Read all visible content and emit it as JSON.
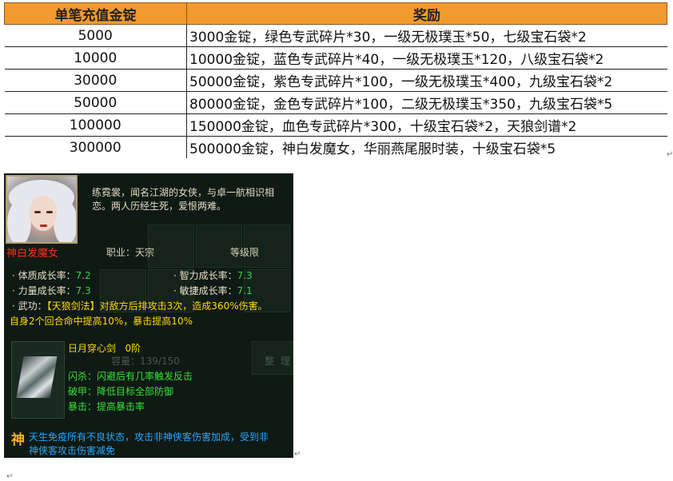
{
  "reward_table": {
    "headers": [
      "单笔充值金锭",
      "奖励"
    ],
    "rows": [
      {
        "amount": "5000",
        "reward": "3000金锭，绿色专武碎片*30，一级无极璞玉*50，七级宝石袋*2"
      },
      {
        "amount": "10000",
        "reward": "10000金锭，蓝色专武碎片*40，一级无极璞玉*120，八级宝石袋*2"
      },
      {
        "amount": "30000",
        "reward": "50000金锭，紫色专武碎片*100，一级无极璞玉*400，九级宝石袋*2"
      },
      {
        "amount": "50000",
        "reward": "80000金锭，金色专武碎片*100，二级无极璞玉*350，九级宝石袋*5"
      },
      {
        "amount": "100000",
        "reward": "150000金锭，血色专武碎片*300，十级宝石袋*2，天狼剑谱*2"
      },
      {
        "amount": "300000",
        "reward": "500000金锭，神白发魔女，华丽燕尾服时装，十级宝石袋*5"
      }
    ]
  },
  "hero": {
    "description": "练霓裳，闻名江湖的女侠，与卓一航相识相恋。两人历经生死，爱恨两难。",
    "name": "神白发魔女",
    "profession": "职业：天宗",
    "level_limit": "等级限",
    "stats": {
      "constitution_label": "体质成长率：",
      "constitution_value": "7.2",
      "intelligence_label": "智力成长率：",
      "intelligence_value": "7.3",
      "strength_label": "力量成长率：",
      "strength_value": "7.3",
      "agility_label": "敏捷成长率：",
      "agility_value": "7.1"
    },
    "martial_art": {
      "label": "武功：",
      "name": "【天狼剑法】",
      "effect_line1": "对敌方后排攻击3次，造成360%伤害。",
      "effect_line2": "自身2个回合命中提高10%，暴击提高10%"
    },
    "weapon": {
      "name": "日月穿心剑",
      "level": "0阶",
      "effects": [
        "闪杀：闪避后有几率触发反击",
        "破甲：降低目标全部防御",
        "暴击：提高暴击率"
      ]
    },
    "divine_badge": "神",
    "divine_line1": "天生免疫所有不良状态，攻击非神侠客伤害加成，受到非",
    "divine_line2": "神侠客攻击伤害减免",
    "background_text": {
      "capacity": "容量：139/150",
      "tab_left": "天",
      "tab_right1": "整",
      "tab_right2": "理"
    }
  },
  "marks": {
    "return_mark": "↵"
  },
  "colors": {
    "header_bg": "#f29a2e",
    "panel_bg": "#0f1a14",
    "hero_name": "#ff2a1a",
    "stat_value": "#3fd24a",
    "martial_name": "#ffd800",
    "weapon_effect": "#38e038",
    "divine_text": "#27a6ff"
  }
}
